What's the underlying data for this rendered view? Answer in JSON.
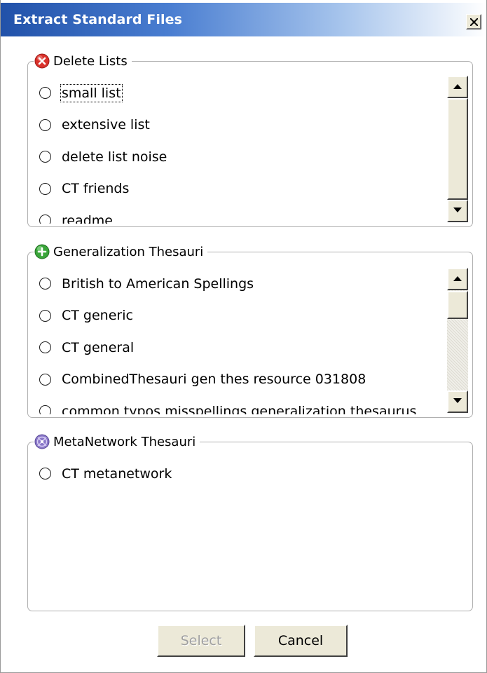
{
  "window": {
    "title": "Extract Standard Files",
    "close_label": "X"
  },
  "groups": {
    "delete_lists": {
      "label": "Delete Lists",
      "icon": "delete-icon",
      "icon_color": "#d9302a",
      "items": [
        "small list",
        "extensive list",
        "delete list noise",
        "CT friends",
        "readme"
      ]
    },
    "generalization": {
      "label": "Generalization Thesauri",
      "icon": "add-icon",
      "icon_color": "#3aa53a",
      "items": [
        "British to American Spellings",
        "CT generic",
        "CT general",
        "CombinedThesauri gen thes resource 031808",
        "common typos misspellings generalization thesaurus"
      ]
    },
    "metanetwork": {
      "label": "MetaNetwork Thesauri",
      "icon": "network-icon",
      "icon_color": "#8a78c8",
      "items": [
        "CT metanetwork"
      ]
    }
  },
  "buttons": {
    "select": "Select",
    "cancel": "Cancel"
  }
}
